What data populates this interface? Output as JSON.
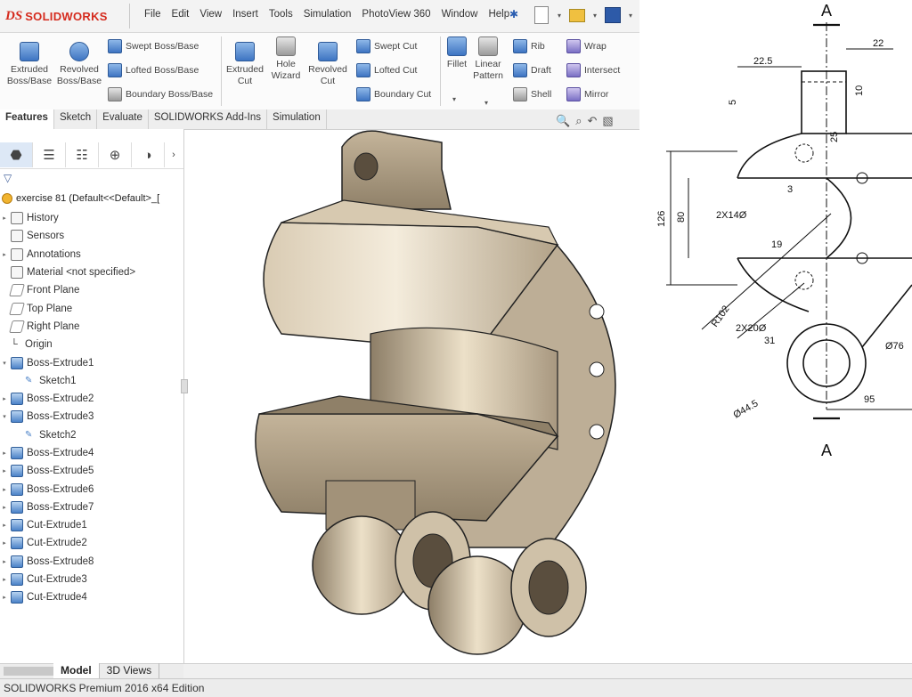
{
  "app": {
    "logo_ds": "DS",
    "logo_name": "SOLIDWORKS"
  },
  "menu": [
    "File",
    "Edit",
    "View",
    "Insert",
    "Tools",
    "Simulation",
    "PhotoView 360",
    "Window",
    "Help"
  ],
  "pin_icon": "pushpin-icon",
  "quick_access": [
    {
      "icon": "new-document-icon"
    },
    {
      "icon": "open-folder-icon"
    },
    {
      "icon": "save-icon"
    }
  ],
  "commands": {
    "extruded_boss": "Extruded Boss/Base",
    "revolved_boss": "Revolved Boss/Base",
    "swept_boss": "Swept Boss/Base",
    "lofted_boss": "Lofted Boss/Base",
    "boundary_boss": "Boundary Boss/Base",
    "extruded_cut": "Extruded Cut",
    "hole_wizard": "Hole Wizard",
    "revolved_cut": "Revolved Cut",
    "swept_cut": "Swept Cut",
    "lofted_cut": "Lofted Cut",
    "boundary_cut": "Boundary Cut",
    "fillet": "Fillet",
    "linear_pattern": "Linear Pattern",
    "rib": "Rib",
    "draft": "Draft",
    "shell": "Shell",
    "wrap": "Wrap",
    "intersect": "Intersect",
    "mirror": "Mirror"
  },
  "tabs": [
    "Features",
    "Sketch",
    "Evaluate",
    "SOLIDWORKS Add-Ins",
    "Simulation"
  ],
  "feature_tree": {
    "root": "exercise 81  (Default<<Default>_[",
    "items": [
      {
        "label": "History",
        "icon": "history-icon"
      },
      {
        "label": "Sensors",
        "icon": "sensors-icon"
      },
      {
        "label": "Annotations",
        "icon": "annotations-icon"
      },
      {
        "label": "Material <not specified>",
        "icon": "material-icon"
      },
      {
        "label": "Front Plane",
        "icon": "plane-icon"
      },
      {
        "label": "Top Plane",
        "icon": "plane-icon"
      },
      {
        "label": "Right Plane",
        "icon": "plane-icon"
      },
      {
        "label": "Origin",
        "icon": "origin-icon"
      },
      {
        "label": "Boss-Extrude1",
        "icon": "extrude-icon"
      },
      {
        "label": "Sketch1",
        "icon": "sketch-icon"
      },
      {
        "label": "Boss-Extrude2",
        "icon": "extrude-icon"
      },
      {
        "label": "Boss-Extrude3",
        "icon": "extrude-icon"
      },
      {
        "label": "Sketch2",
        "icon": "sketch-icon"
      },
      {
        "label": "Boss-Extrude4",
        "icon": "extrude-icon"
      },
      {
        "label": "Boss-Extrude5",
        "icon": "extrude-icon"
      },
      {
        "label": "Boss-Extrude6",
        "icon": "extrude-icon"
      },
      {
        "label": "Boss-Extrude7",
        "icon": "extrude-icon"
      },
      {
        "label": "Cut-Extrude1",
        "icon": "cut-extrude-icon"
      },
      {
        "label": "Cut-Extrude2",
        "icon": "cut-extrude-icon"
      },
      {
        "label": "Boss-Extrude8",
        "icon": "extrude-icon"
      },
      {
        "label": "Cut-Extrude3",
        "icon": "cut-extrude-icon"
      },
      {
        "label": "Cut-Extrude4",
        "icon": "cut-extrude-icon"
      }
    ]
  },
  "bottom_tabs": [
    "Model",
    "3D Views"
  ],
  "status": "SOLIDWORKS Premium 2016 x64 Edition",
  "drawing": {
    "section_label": "A",
    "dims": {
      "d22": "22",
      "d22_5": "22.5",
      "d5": "5",
      "d10": "10",
      "d25": "25",
      "d126": "126",
      "d80": "80",
      "d3": "3",
      "hole140": "2X14Ø",
      "d19": "19",
      "r102": "R102",
      "hole200": "2X20Ø",
      "d31": "31",
      "dia76": "Ø76",
      "dia44_5": "Ø44.5",
      "d95": "95"
    }
  },
  "colors": {
    "brand": "#d52b1e",
    "part_shade": "#b8a993",
    "part_light": "#ece2cf"
  }
}
